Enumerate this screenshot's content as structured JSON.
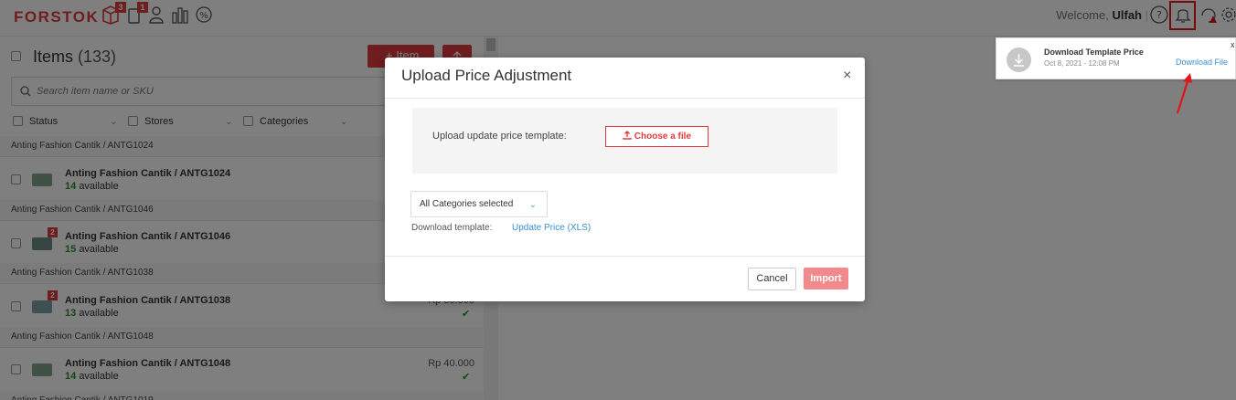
{
  "header": {
    "logo": "FORSTOK",
    "nav_badges": {
      "orders": "3",
      "inventory": "1"
    },
    "welcome_prefix": "Welcome,",
    "username": "Ulfah"
  },
  "items_panel": {
    "title": "Items",
    "count": "(133)",
    "add_item_label": "+ Item",
    "search_placeholder": "Search item name or SKU",
    "filters": [
      "Status",
      "Stores",
      "Categories"
    ],
    "groups": [
      {
        "header": "Anting Fashion Cantik / ANTG1024",
        "name": "Anting Fashion Cantik / ANTG1024",
        "available_count": "14",
        "available_label": "available",
        "badge": "",
        "price": ""
      },
      {
        "header": "Anting Fashion Cantik / ANTG1046",
        "name": "Anting Fashion Cantik / ANTG1046",
        "available_count": "15",
        "available_label": "available",
        "badge": "2",
        "price": ""
      },
      {
        "header": "Anting Fashion Cantik / ANTG1038",
        "name": "Anting Fashion Cantik / ANTG1038",
        "available_count": "13",
        "available_label": "available",
        "badge": "2",
        "price": "Rp 30.000"
      },
      {
        "header": "Anting Fashion Cantik / ANTG1048",
        "name": "Anting Fashion Cantik / ANTG1048",
        "available_count": "14",
        "available_label": "available",
        "badge": "",
        "price": "Rp 40.000"
      }
    ],
    "partial_header": "Anting Fashion Cantik / ANTG1019"
  },
  "notification": {
    "title": "Download Template Price",
    "date": "Oct 8, 2021 - 12:08 PM",
    "link": "Download File",
    "close": "x"
  },
  "modal": {
    "title": "Upload Price Adjustment",
    "close": "×",
    "upload_label": "Upload update price template:",
    "choose_file": "Choose a file",
    "category_select": "All Categories selected",
    "download_label": "Download template:",
    "download_link": "Update Price (XLS)",
    "cancel": "Cancel",
    "import": "Import"
  },
  "colors": {
    "brand": "#e03a3e",
    "link": "#3a8fd0",
    "available": "#2e8b2e",
    "import_disabled": "#f2898d"
  }
}
